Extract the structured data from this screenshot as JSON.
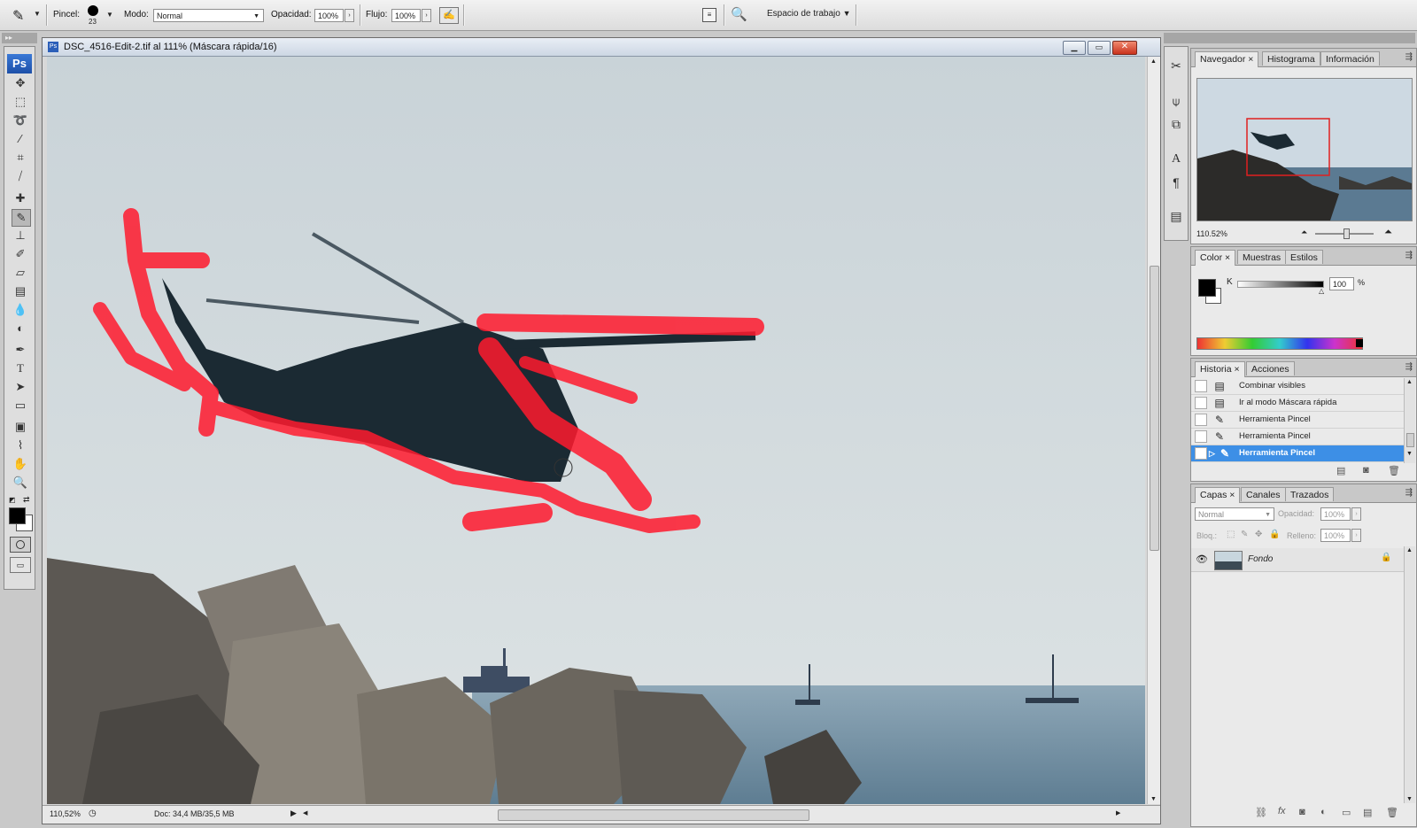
{
  "options_bar": {
    "brush_label": "Pincel:",
    "brush_size": "23",
    "mode_label": "Modo:",
    "mode_value": "Normal",
    "opacity_label": "Opacidad:",
    "opacity_value": "100%",
    "flow_label": "Flujo:",
    "flow_value": "100%",
    "workspace_label": "Espacio de trabajo"
  },
  "toolbox": {
    "logo": "Ps"
  },
  "document": {
    "title": "DSC_4516-Edit-2.tif al 111% (Máscara rápida/16)",
    "zoom": "110,52%",
    "doc_size": "Doc: 34,4 MB/35,5 MB"
  },
  "navigator_panel": {
    "tabs": [
      "Navegador",
      "Histograma",
      "Información"
    ],
    "zoom": "110.52%"
  },
  "color_panel": {
    "tabs": [
      "Color",
      "Muestras",
      "Estilos"
    ],
    "channel_label": "K",
    "channel_value": "100",
    "unit": "%"
  },
  "history_panel": {
    "tabs": [
      "Historia",
      "Acciones"
    ],
    "items": [
      "Combinar visibles",
      "Ir al modo Máscara rápida",
      "Herramienta Pincel",
      "Herramienta Pincel",
      "Herramienta Pincel"
    ],
    "selected_index": 4
  },
  "layers_panel": {
    "tabs": [
      "Capas",
      "Canales",
      "Trazados"
    ],
    "blend_mode": "Normal",
    "opacity_label": "Opacidad:",
    "opacity_value": "100%",
    "lock_label": "Bloq.:",
    "fill_label": "Relleno:",
    "fill_value": "100%",
    "layers": [
      {
        "name": "Fondo"
      }
    ]
  },
  "colors": {
    "quick_mask": "#ff1a2e",
    "selection": "#3d8fe6",
    "nav_view_box": "#e02020"
  }
}
